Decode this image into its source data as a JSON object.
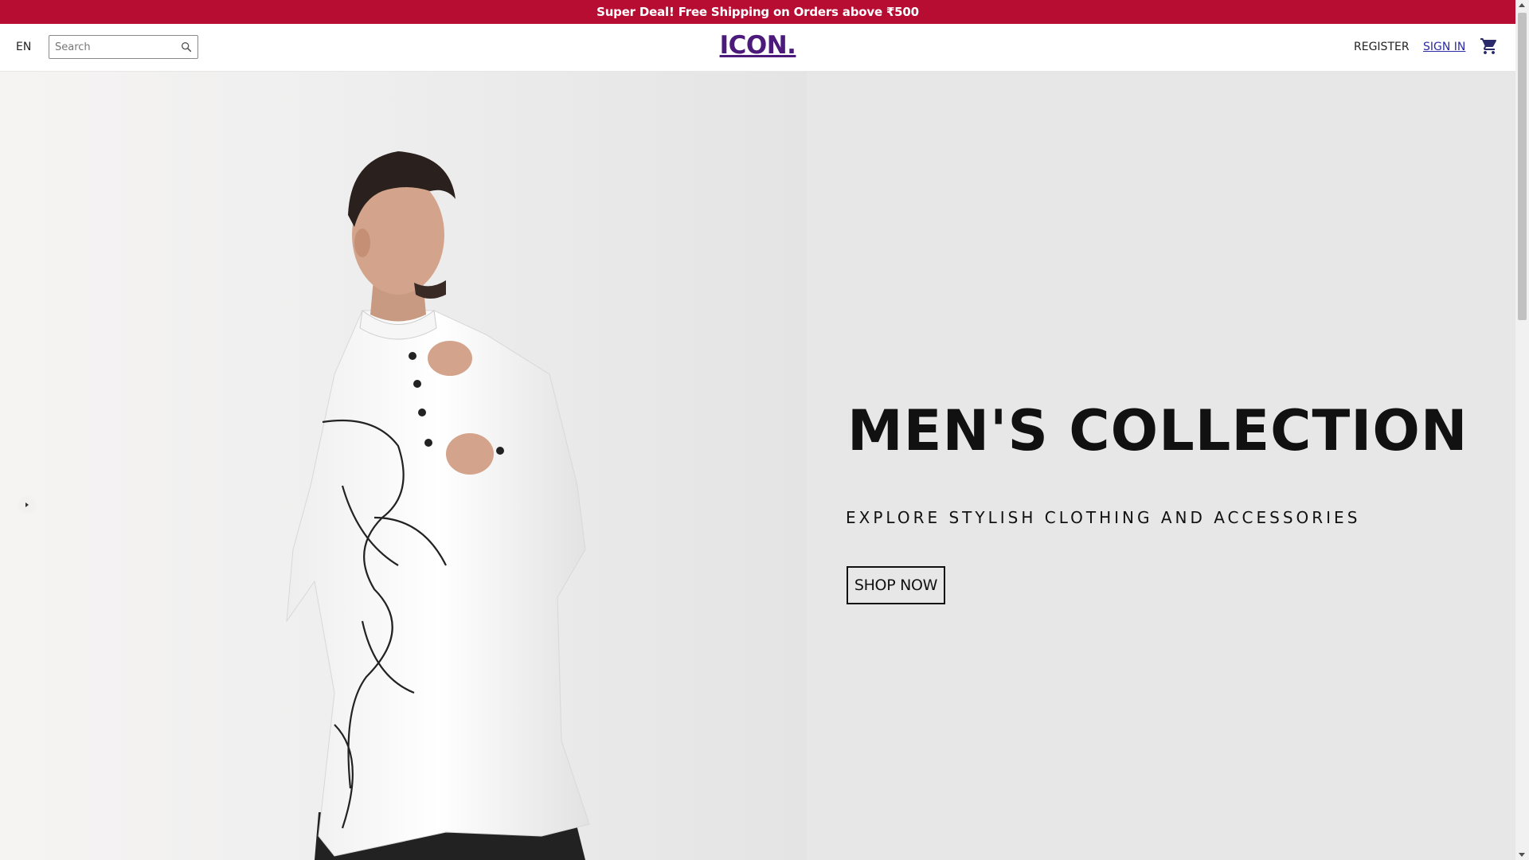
{
  "promo": {
    "text": "Super Deal! Free Shipping on Orders above ₹500"
  },
  "header": {
    "language": "EN",
    "search": {
      "placeholder": "Search",
      "value": ""
    },
    "logo": "ICON.",
    "register": "REGISTER",
    "signin": "SIGN IN",
    "icons": {
      "search": "search-icon",
      "cart": "cart-icon"
    }
  },
  "hero": {
    "title": "MEN'S COLLECTION",
    "subtitle": "EXPLORE STYLISH CLOTHING AND ACCESSORIES",
    "cta": "SHOP NOW",
    "image": "model wearing white kurta with line-art print",
    "prev_icon": "chevron-left-icon"
  },
  "colors": {
    "promo_bg": "#b80d33",
    "logo": "#4b1a7a",
    "signin_link": "#2d2aa5",
    "hero_bg": "#e8e7e7"
  }
}
